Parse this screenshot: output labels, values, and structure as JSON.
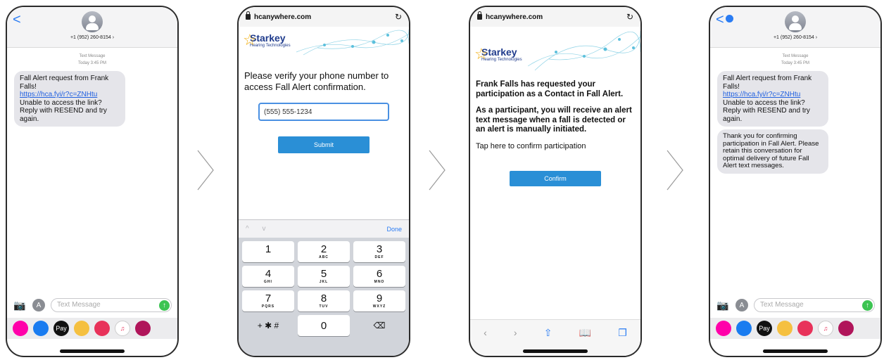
{
  "messages": {
    "contact": "+1 (952) 260-8154 ›",
    "timestamp_label": "Text Message",
    "timestamp_time": "Today 3:45 PM",
    "alert_text_a": "Fall Alert request from Frank Falls!",
    "alert_link": "https://hca.fyi/r?c=ZNHtu",
    "alert_text_b": "Unable to access the link? Reply with RESEND and try again.",
    "thanks_text": "Thank you for confirming participation in Fall Alert. Please retain this conversation for optimal delivery of future Fall Alert text messages.",
    "compose_placeholder": "Text Message",
    "back_glyph": "<",
    "apps_glyph": "A",
    "send_glyph": "↑",
    "camera_glyph": "📷",
    "applepay_label": "Pay"
  },
  "browser": {
    "url": "hcanywhere.com",
    "reload_glyph": "↻",
    "logo_title": "Starkey",
    "logo_subtitle": "Hearing Technologies",
    "verify_prompt": "Please verify your phone number to access Fall Alert confirmation.",
    "phone_value": "(555) 555-1234",
    "submit_label": "Submit",
    "done_label": "Done",
    "toolbar_chevrons": "^ v",
    "keys": [
      {
        "n": "1",
        "l": ""
      },
      {
        "n": "2",
        "l": "ABC"
      },
      {
        "n": "3",
        "l": "DEF"
      },
      {
        "n": "4",
        "l": "GHI"
      },
      {
        "n": "5",
        "l": "JKL"
      },
      {
        "n": "6",
        "l": "MNO"
      },
      {
        "n": "7",
        "l": "PQRS"
      },
      {
        "n": "8",
        "l": "TUV"
      },
      {
        "n": "9",
        "l": "WXYZ"
      }
    ],
    "key_symbols": "+ ✱ #",
    "key_zero": "0",
    "key_delete": "⌫",
    "participate_a": "Frank Falls has requested your participation as a Contact in Fall Alert.",
    "participate_b": "As a participant, you will receive an alert text message when a fall is detected or an alert is manually initiated.",
    "tap_text": "Tap here to confirm participation",
    "confirm_label": "Confirm",
    "safari": {
      "back": "‹",
      "forward": "›",
      "share": "⇧",
      "bookmarks": "📖",
      "tabs": "❐"
    }
  },
  "colors": {
    "accent": "#2a8fd6",
    "ios_blue": "#2a7cf3",
    "send_green": "#3cc452",
    "bubble_gray": "#e5e5ea"
  }
}
